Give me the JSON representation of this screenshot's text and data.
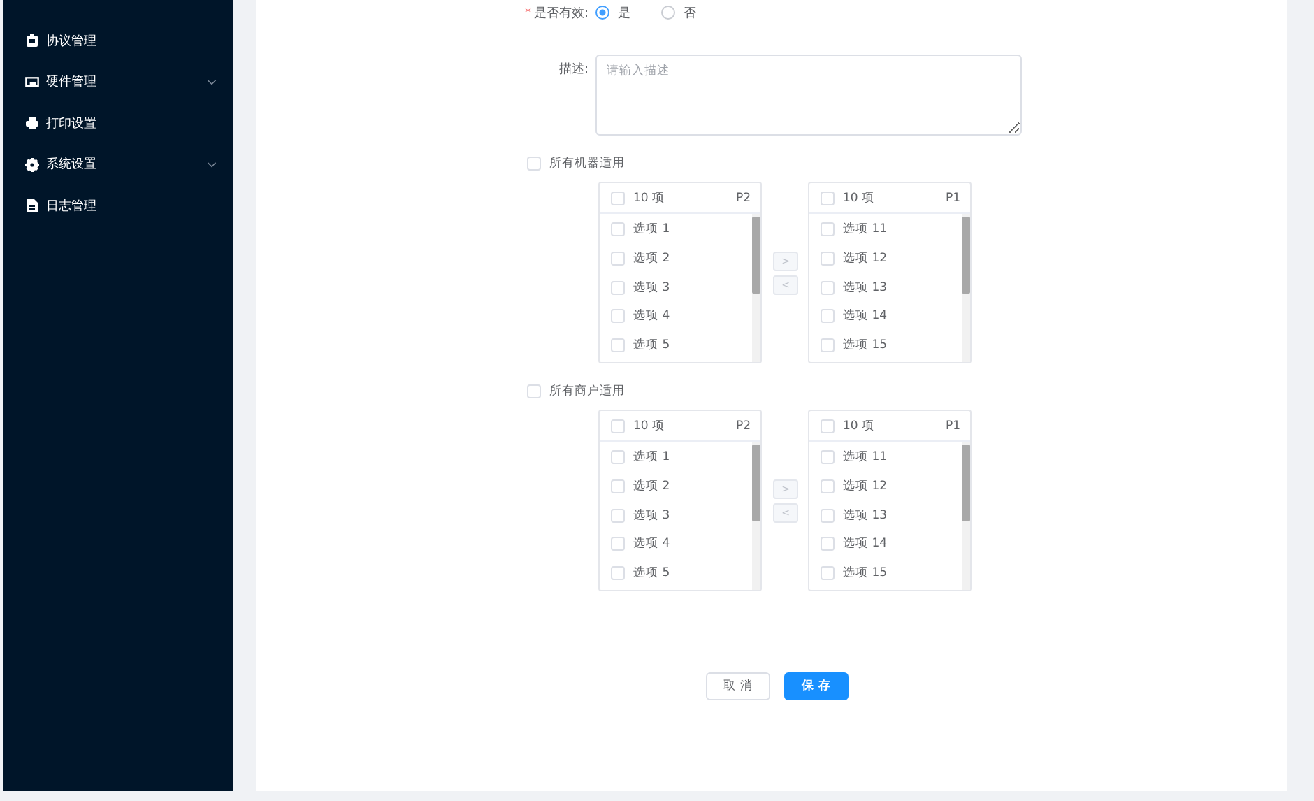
{
  "sidebar": {
    "items": [
      {
        "label": "协议管理",
        "has_submenu": false
      },
      {
        "label": "硬件管理",
        "has_submenu": true
      },
      {
        "label": "打印设置",
        "has_submenu": false
      },
      {
        "label": "系统设置",
        "has_submenu": true
      },
      {
        "label": "日志管理",
        "has_submenu": false
      }
    ]
  },
  "form": {
    "valid_field": {
      "label": "是否有效:",
      "required_mark": "*",
      "options": [
        {
          "label": "是",
          "selected": true
        },
        {
          "label": "否",
          "selected": false
        }
      ]
    },
    "description": {
      "label": "描述:",
      "placeholder": "请输入描述"
    },
    "scopes": [
      {
        "label": "所有机器适用",
        "checked": false,
        "transfer": {
          "source": {
            "count": "10 项",
            "page": "P2",
            "checked": false,
            "items": [
              {
                "label": "选项 1",
                "checked": false
              },
              {
                "label": "选项 2",
                "checked": false
              },
              {
                "label": "选项 3",
                "checked": false
              },
              {
                "label": "选项 4",
                "checked": false
              },
              {
                "label": "选项 5",
                "checked": false
              }
            ]
          },
          "buttons": [
            {
              "label": ">",
              "disabled": true
            },
            {
              "label": "<",
              "disabled": true
            }
          ],
          "target": {
            "count": "10 项",
            "page": "P1",
            "checked": false,
            "items": [
              {
                "label": "选项 11",
                "checked": false
              },
              {
                "label": "选项 12",
                "checked": false
              },
              {
                "label": "选项 13",
                "checked": false
              },
              {
                "label": "选项 14",
                "checked": false
              },
              {
                "label": "选项 15",
                "checked": false
              }
            ]
          }
        }
      },
      {
        "label": "所有商户适用",
        "checked": false,
        "transfer": {
          "source": {
            "count": "10 项",
            "page": "P2",
            "checked": false,
            "items": [
              {
                "label": "选项 1",
                "checked": false
              },
              {
                "label": "选项 2",
                "checked": false
              },
              {
                "label": "选项 3",
                "checked": false
              },
              {
                "label": "选项 4",
                "checked": false
              },
              {
                "label": "选项 5",
                "checked": false
              }
            ]
          },
          "buttons": [
            {
              "label": ">",
              "disabled": true
            },
            {
              "label": "<",
              "disabled": true
            }
          ],
          "target": {
            "count": "10 项",
            "page": "P1",
            "checked": false,
            "items": [
              {
                "label": "选项 11",
                "checked": false
              },
              {
                "label": "选项 12",
                "checked": false
              },
              {
                "label": "选项 13",
                "checked": false
              },
              {
                "label": "选项 14",
                "checked": false
              },
              {
                "label": "选项 15",
                "checked": false
              }
            ]
          }
        }
      }
    ],
    "actions": [
      {
        "label": "取 消",
        "kind": "default"
      },
      {
        "label": "保 存",
        "kind": "primary"
      }
    ]
  }
}
